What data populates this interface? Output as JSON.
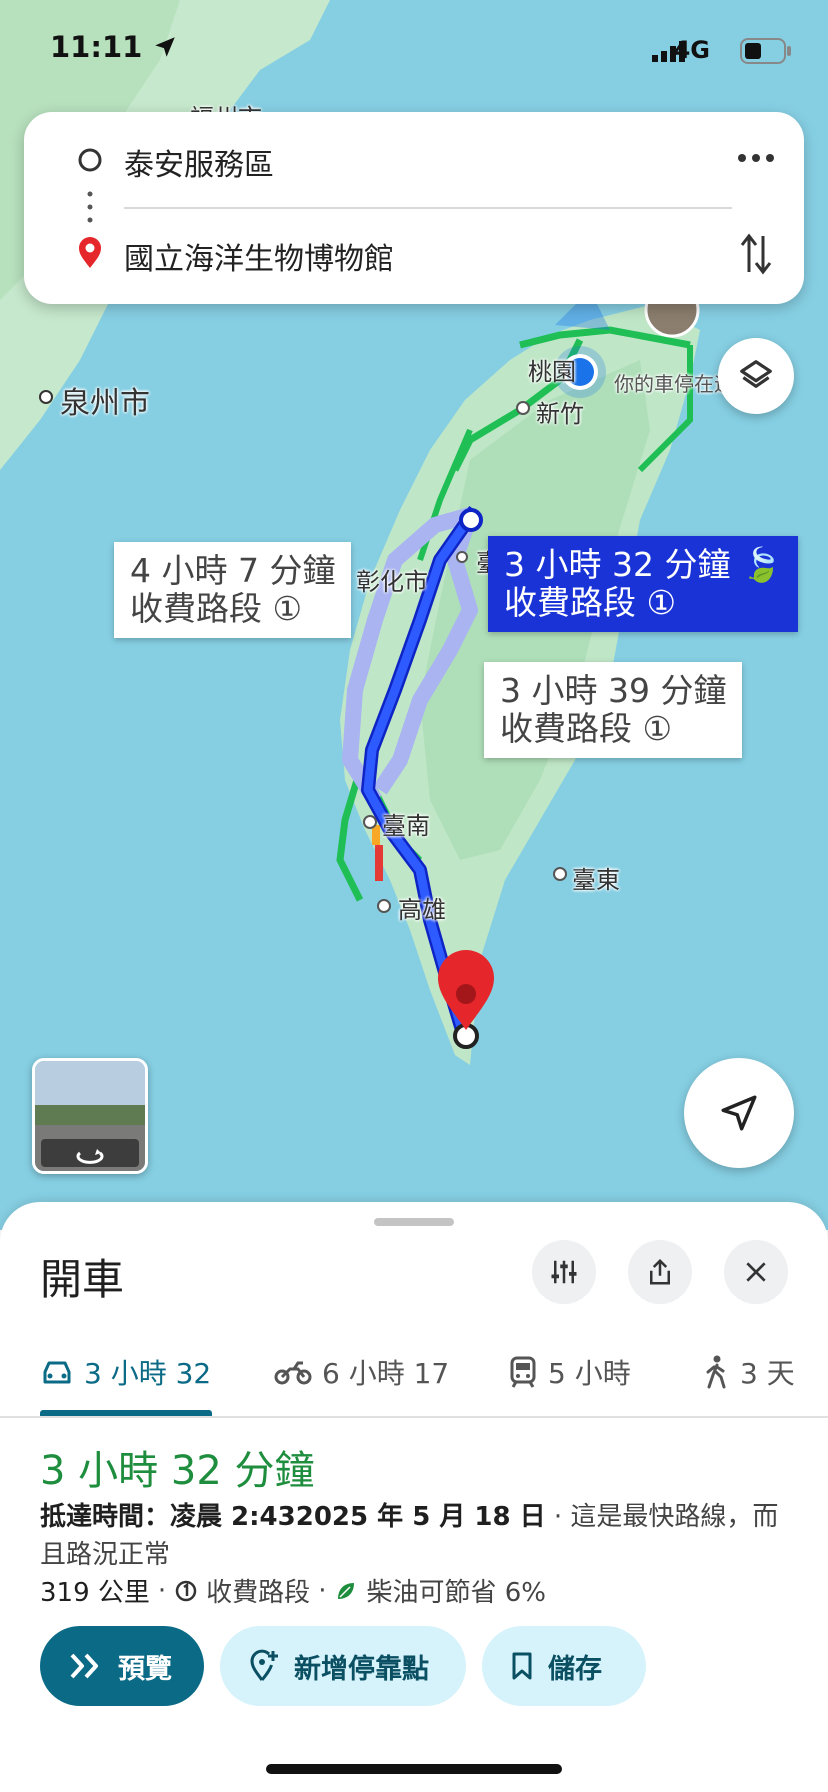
{
  "status_bar": {
    "time": "11:11",
    "network": "4G"
  },
  "search": {
    "origin": "泰安服務區",
    "destination": "國立海洋生物博物館"
  },
  "map_labels": {
    "fuzhou": "福州市",
    "quanzhou": "泉州市",
    "taoyuan": "桃園",
    "hsinchu": "新竹",
    "parked": "你的車停在這",
    "changhua": "彰化市",
    "taichung": "臺",
    "tainan": "臺南",
    "kaohsiung": "高雄",
    "taitung": "臺東"
  },
  "routes": [
    {
      "time": "3 小時 32 分鐘",
      "note": "收費路段",
      "selected": true
    },
    {
      "time": "4 小時 7 分鐘",
      "note": "收費路段",
      "selected": false
    },
    {
      "time": "3 小時 39 分鐘",
      "note": "收費路段",
      "selected": false
    }
  ],
  "sheet": {
    "title": "開車",
    "modes": [
      {
        "label": "3 小時 32",
        "icon": "car-icon",
        "active": true
      },
      {
        "label": "6 小時 17",
        "icon": "motorcycle-icon",
        "active": false
      },
      {
        "label": "5 小時",
        "icon": "train-icon",
        "active": false
      },
      {
        "label": "3 天",
        "icon": "walk-icon",
        "active": false
      }
    ],
    "duration": "3 小時 32 分鐘",
    "arrival_prefix": "抵達時間：凌晨 2:432025 年 5 月 18 日",
    "arrival_suffix": " · 這是最快路線，而且路況正常",
    "distance": "319 公里",
    "toll": "收費路段",
    "fuel_saving": "柴油可節省 6%",
    "actions": {
      "preview": "預覽",
      "add_stop": "新增停靠點",
      "save": "儲存"
    }
  },
  "colors": {
    "selected_route": "#1a33d6",
    "alt_route": "#a9b4f0",
    "accent": "#0b6a86",
    "duration_green": "#1e8e3e",
    "sea": "#86cfe3",
    "land": "#bfe7c7"
  }
}
